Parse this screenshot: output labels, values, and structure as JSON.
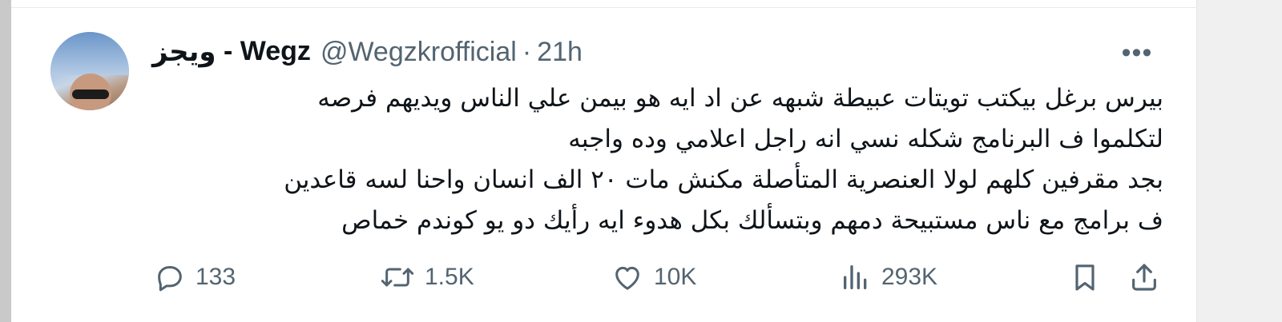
{
  "tweet": {
    "display_name": "Wegz - ويجز",
    "display_name_latin": "Wegz",
    "display_name_sep": " - ",
    "display_name_arabic": "ويجز",
    "handle": "@Wegzkrofficial",
    "separator": "·",
    "time": "21h",
    "more_label": "•••",
    "text_lines": [
      "بيرس برغل بيكتب تويتات عبيطة شبهه عن اد ايه هو بيمن علي الناس ويديهم فرصه",
      "لتكلموا ف البرنامج شكله نسي انه راجل اعلامي وده واجبه",
      "بجد مقرفين كلهم لولا العنصرية المتأصلة مكنش مات ٢٠ الف انسان واحنا لسه قاعدين",
      "ف برامج مع ناس مستبيحة دمهم وبتسألك بكل هدوء ايه رأيك دو يو كوندم خماص"
    ]
  },
  "actions": {
    "replies": {
      "icon": "reply-icon",
      "count": "133"
    },
    "retweets": {
      "icon": "retweet-icon",
      "count": "1.5K"
    },
    "likes": {
      "icon": "heart-icon",
      "count": "10K"
    },
    "views": {
      "icon": "views-icon",
      "count": "293K"
    },
    "bookmark": {
      "icon": "bookmark-icon"
    },
    "share": {
      "icon": "share-icon"
    }
  },
  "colors": {
    "text_primary": "#0f1419",
    "text_secondary": "#536471",
    "background": "#ffffff",
    "page_background": "#f0f0f0"
  }
}
